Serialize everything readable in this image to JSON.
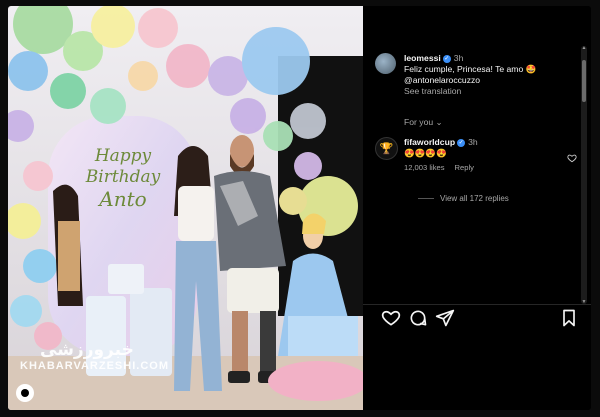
{
  "post": {
    "watermark_fa": "خبرورزشی",
    "watermark_en": "KHABARVARZESHI.COM",
    "banner": {
      "line1": "Happy",
      "line2": "Birthday",
      "line3": "Anto"
    }
  },
  "comments": [
    {
      "username": "leomessi",
      "time": "3h",
      "text": "Feliz cumple, Princesa! Te amo 🤩",
      "mention": "@antonelaroccuzzo",
      "see_translation": "See translation"
    },
    {
      "username": "fifaworldcup",
      "time": "3h",
      "text": "😍😍😍😍",
      "likes": "12,003 likes",
      "reply": "Reply",
      "view_replies": "View all 172 replies"
    }
  ],
  "for_you_label": "For you",
  "icons": {
    "heart": "heart-icon",
    "comment": "comment-icon",
    "share": "share-icon",
    "save": "bookmark-icon",
    "verified": "verified-icon",
    "chevron": "chevron-down-icon"
  },
  "colors": {
    "verified": "#3a8ef6",
    "panel_bg": "#000000",
    "muted": "#a8a8a8"
  }
}
